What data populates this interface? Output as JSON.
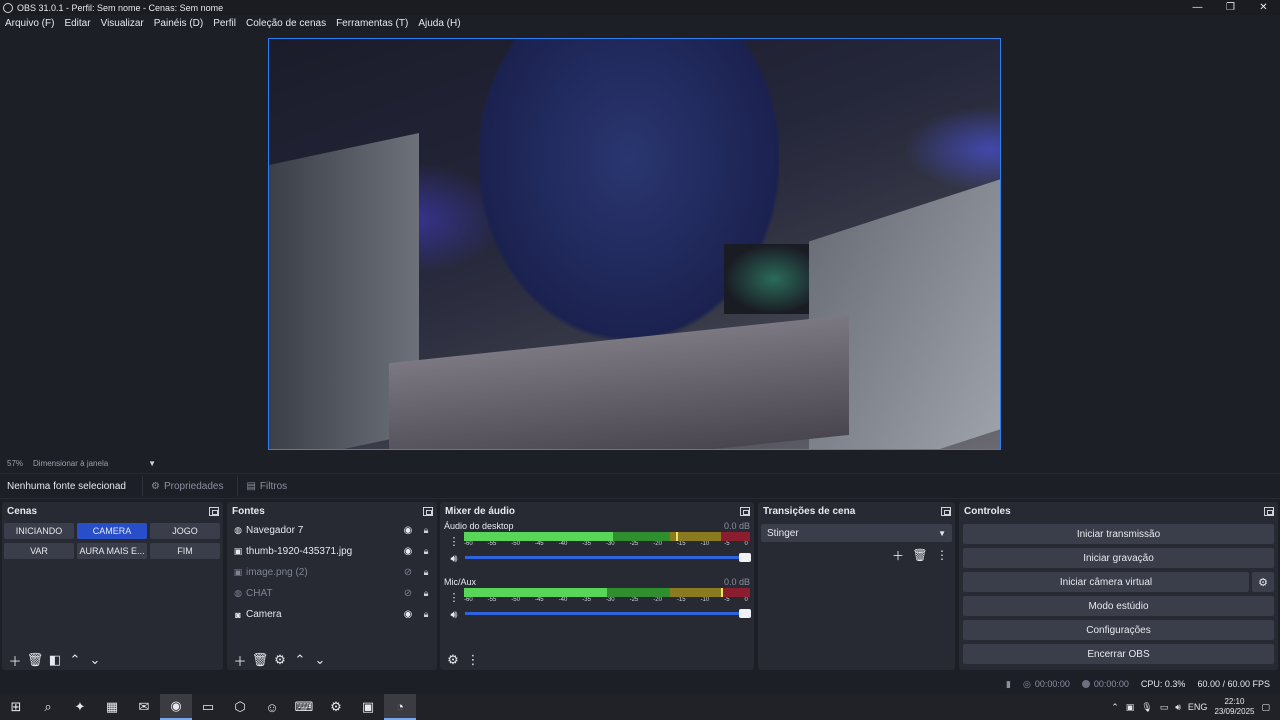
{
  "window": {
    "title": "OBS 31.0.1 - Perfil: Sem nome - Cenas: Sem nome"
  },
  "menu": [
    "Arquivo (F)",
    "Editar",
    "Visualizar",
    "Painéis (D)",
    "Perfil",
    "Coleção de cenas",
    "Ferramentas (T)",
    "Ajuda (H)"
  ],
  "preview": {
    "zoom": "57%",
    "scale_mode": "Dimensionar à janela"
  },
  "source_toolbar": {
    "no_source": "Nenhuma fonte selecionad",
    "properties": "Propriedades",
    "filters": "Filtros"
  },
  "scenes": {
    "title": "Cenas",
    "items": [
      {
        "label": "INICIANDO",
        "active": false
      },
      {
        "label": "CAMERA",
        "active": true
      },
      {
        "label": "JOGO",
        "active": false
      },
      {
        "label": "VAR",
        "active": false
      },
      {
        "label": "AURA MAIS E...",
        "active": false
      },
      {
        "label": "FIM",
        "active": false
      }
    ]
  },
  "sources": {
    "title": "Fontes",
    "items": [
      {
        "label": "Navegador 7",
        "icon": "globe-icon",
        "visible": true
      },
      {
        "label": "thumb-1920-435371.jpg",
        "icon": "image-icon",
        "visible": true
      },
      {
        "label": "image.png (2)",
        "icon": "image-icon",
        "visible": false
      },
      {
        "label": "CHAT",
        "icon": "globe-icon",
        "visible": false
      },
      {
        "label": "Camera",
        "icon": "camera-icon",
        "visible": true
      }
    ]
  },
  "mixer": {
    "title": "Mixer de áudio",
    "channels": [
      {
        "name": "Áudio do desktop",
        "db": "0.0 dB",
        "level": 0.52,
        "peak": 0.74
      },
      {
        "name": "Mic/Aux",
        "db": "0.0 dB",
        "level": 0.5,
        "peak": 0.9
      }
    ],
    "ticks": [
      "-60",
      "-55",
      "-50",
      "-45",
      "-40",
      "-35",
      "-30",
      "-25",
      "-20",
      "-15",
      "-10",
      "-5",
      "0"
    ]
  },
  "transitions": {
    "title": "Transições de cena",
    "selected": "Stinger"
  },
  "controls": {
    "title": "Controles",
    "start_stream": "Iniciar transmissão",
    "start_record": "Iniciar gravação",
    "start_virtual_cam": "Iniciar câmera virtual",
    "studio_mode": "Modo estúdio",
    "settings": "Configurações",
    "exit": "Encerrar OBS"
  },
  "status": {
    "stream_time": "00:00:00",
    "record_time": "00:00:00",
    "cpu": "CPU: 0.3%",
    "fps": "60.00 / 60.00 FPS"
  },
  "taskbar": {
    "lang": "ENG",
    "time": "22:10",
    "date": "23/09/2025"
  },
  "colors": {
    "accent": "#2f7ff2",
    "active_scene": "#284fc9",
    "panel": "#272a33",
    "background": "#1d1f26"
  }
}
